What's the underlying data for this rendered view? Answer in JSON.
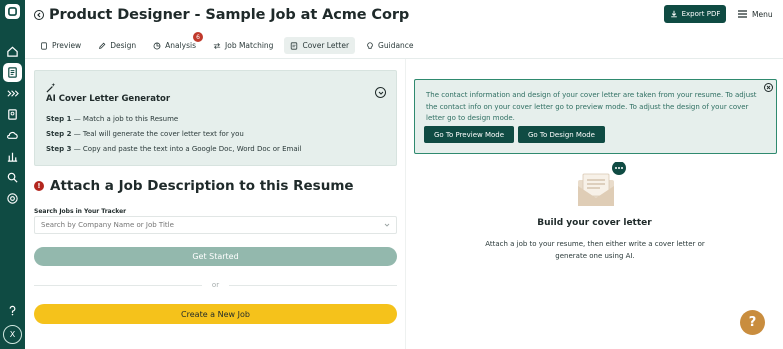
{
  "sidebar": {
    "items": [
      "home-icon",
      "document-icon",
      "chevrons-right-icon",
      "resume-icon",
      "cloud-icon",
      "chart-icon",
      "search-icon",
      "target-icon"
    ],
    "help_icon": "question-icon",
    "avatar_initial": "X"
  },
  "header": {
    "title": "Product Designer - Sample Job at Acme Corp",
    "export_label": "Export PDF",
    "menu_label": "Menu"
  },
  "tabs": [
    {
      "label": "Preview"
    },
    {
      "label": "Design"
    },
    {
      "label": "Analysis",
      "badge": "6"
    },
    {
      "label": "Job Matching"
    },
    {
      "label": "Cover Letter"
    },
    {
      "label": "Guidance"
    }
  ],
  "generator": {
    "title": "AI Cover Letter Generator",
    "steps": [
      {
        "num": "Step 1",
        "text": " — Match a job to this Resume"
      },
      {
        "num": "Step 2",
        "text": " — Teal will generate the cover letter text for you"
      },
      {
        "num": "Step 3",
        "text": " — Copy and paste the text into a Google Doc, Word Doc or Email"
      }
    ]
  },
  "attach": {
    "title": "Attach a Job Description to this Resume",
    "search_label": "Search Jobs in Your Tracker",
    "search_placeholder": "Search by Company Name or Job Title",
    "start_label": "Get Started",
    "or_label": "or",
    "create_label": "Create a New Job"
  },
  "info": {
    "text": "The contact information and design of your cover letter are taken from your resume. To adjust the contact info on your cover letter go to preview mode. To adjust the design of your cover letter go to design mode.",
    "preview_btn": "Go To Preview Mode",
    "design_btn": "Go To Design Mode"
  },
  "empty_state": {
    "title": "Build your cover letter",
    "desc": "Attach a job to your resume, then either write a cover letter or generate one using AI."
  },
  "help_label": "?",
  "colors": {
    "brand": "#0f4b43",
    "accent_yellow": "#f5c21b",
    "muted_green": "#93b8ad",
    "danger": "#b3261e"
  }
}
